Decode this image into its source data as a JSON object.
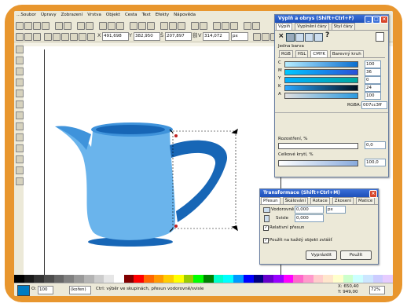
{
  "menu": [
    "…Soubor",
    "Úpravy",
    "Zobrazení",
    "Vrstva",
    "Objekt",
    "Cesta",
    "Text",
    "Efekty",
    "Nápověda"
  ],
  "toolbar": {
    "x_value": "491,698",
    "y_value": "382,950",
    "w_value": "207,897",
    "h_value": "314,072",
    "unit": "px",
    "x_label": "X",
    "y_label": "Y",
    "w_label": "Š",
    "h_label": "V"
  },
  "fill_panel": {
    "title": "Výplň a obrys (Shift+Ctrl+F)",
    "tabs": [
      "Výplň",
      "Vyplnění čáry",
      "Styl čáry"
    ],
    "mode_label": "Jedna barva",
    "color_tabs": [
      "RGB",
      "HSL",
      "CMYK",
      "Barevný kruh"
    ],
    "channels": [
      {
        "name": "C",
        "value": "100",
        "gradient": "linear-gradient(90deg,#b5ecff,#0a6fd0)"
      },
      {
        "name": "M",
        "value": "36",
        "gradient": "linear-gradient(90deg,#00c8ff,#2a4fd8)"
      },
      {
        "name": "Y",
        "value": "0",
        "gradient": "linear-gradient(90deg,#00b0ff,#00a8a0)"
      },
      {
        "name": "K",
        "value": "24",
        "gradient": "linear-gradient(90deg,#2aa8ff,#001020)"
      },
      {
        "name": "A",
        "value": "100",
        "gradient": "linear-gradient(90deg,#e0e0e0,#2a9ae0)"
      }
    ],
    "rgba_label": "RGBA:",
    "rgba_value": "007cc3ff",
    "blur_label": "Rozostření, %",
    "blur_value": "0,0",
    "opacity_label": "Celkové krytí, %",
    "opacity_value": "100,0",
    "swatch_color": "#007cc3"
  },
  "transform_panel": {
    "title": "Transformace (Shift+Ctrl+M)",
    "tabs": [
      "Přesun",
      "Škálování",
      "Rotace",
      "Zkosení",
      "Matice"
    ],
    "horizontal_label": "Vodorovně",
    "horizontal_value": "0,000",
    "vertical_label": "Svisle",
    "vertical_value": "0,000",
    "unit": "px",
    "relative_label": "Relativní přesun",
    "apply_each_label": "Použít na každý objekt zvlášť",
    "clear_button": "Vyprázdit",
    "apply_button": "Použít"
  },
  "status": {
    "opacity_label": "O:",
    "opacity_value": "100",
    "layer": "(kořen)",
    "message": "Ctrl: výběr ve skupinách, přesun vodorovně/svisle",
    "cursor_x": "X: 650,40",
    "cursor_y": "Y: 949,00",
    "zoom": "72%"
  },
  "colors": {
    "frame": "#e8962e",
    "jug_light": "#6ab4ec",
    "jug_mid": "#3f93db",
    "jug_dark": "#1766b6",
    "title_bar": "#2a5fcf"
  },
  "palette": [
    "#000000",
    "#1a1a1a",
    "#333333",
    "#4d4d4d",
    "#666666",
    "#808080",
    "#999999",
    "#b3b3b3",
    "#cccccc",
    "#e6e6e6",
    "#ffffff",
    "#800000",
    "#ff0000",
    "#ff6600",
    "#ff9900",
    "#ffcc00",
    "#ffff00",
    "#99cc00",
    "#00ff00",
    "#008000",
    "#00ffcc",
    "#00ffff",
    "#0099ff",
    "#0000ff",
    "#000080",
    "#6600cc",
    "#9900ff",
    "#ff00ff",
    "#ff66cc",
    "#ff99cc",
    "#ffcccc",
    "#ffe6cc",
    "#ffffcc",
    "#ccffcc",
    "#ccffff",
    "#cce6ff",
    "#ccccff",
    "#e6ccff"
  ]
}
